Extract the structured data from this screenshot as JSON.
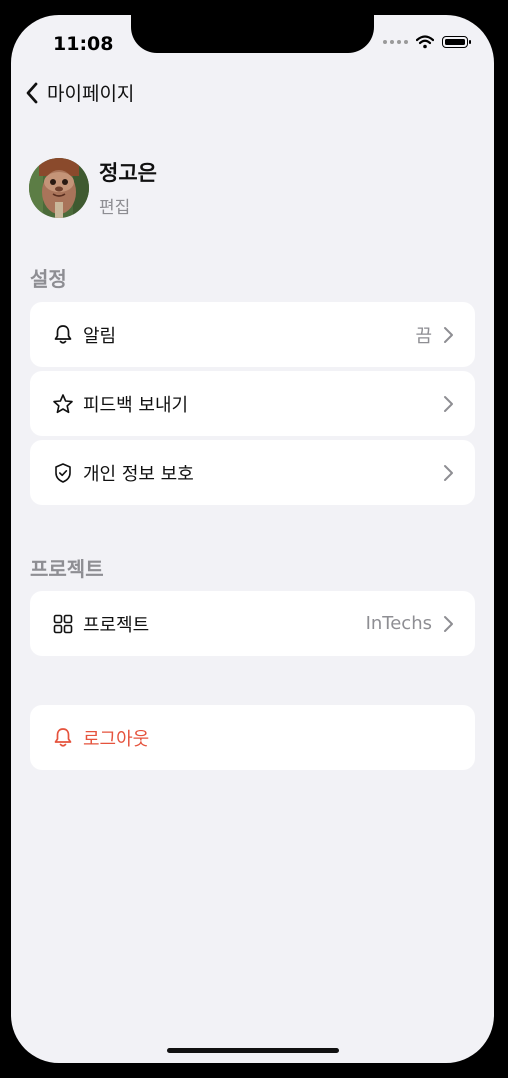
{
  "status_bar": {
    "time": "11:08"
  },
  "nav": {
    "back_title": "마이페이지"
  },
  "profile": {
    "name": "정고은",
    "edit_label": "편집"
  },
  "sections": {
    "settings": {
      "title": "설정",
      "items": [
        {
          "label": "알림",
          "value": "끔",
          "icon": "bell-icon"
        },
        {
          "label": "피드백 보내기",
          "value": "",
          "icon": "star-icon"
        },
        {
          "label": "개인 정보 보호",
          "value": "",
          "icon": "shield-check-icon"
        }
      ]
    },
    "project": {
      "title": "프로젝트",
      "items": [
        {
          "label": "프로젝트",
          "value": "InTechs",
          "icon": "grid-icon"
        }
      ]
    },
    "logout": {
      "label": "로그아웃",
      "icon": "bell-icon",
      "color": "#e5533d"
    }
  },
  "colors": {
    "background": "#f2f2f6",
    "card": "#ffffff",
    "secondary_text": "#8e8e93",
    "destructive": "#e5533d"
  }
}
